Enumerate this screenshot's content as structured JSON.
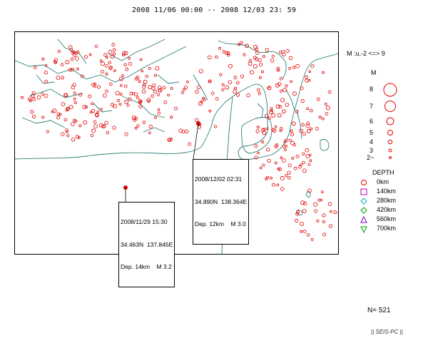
{
  "period": "2008  11/06 00:00 --  2008  12/03  23: 59",
  "legend": {
    "magnitude_range": "M :u,-2 <=> 9",
    "magnitude_title": "M",
    "magnitudes": [
      {
        "label": "8",
        "value": 8
      },
      {
        "label": "7",
        "value": 7
      },
      {
        "label": "6",
        "value": 6
      },
      {
        "label": "5",
        "value": 5
      },
      {
        "label": "4",
        "value": 4
      },
      {
        "label": "3",
        "value": 3
      },
      {
        "label": "2~",
        "value": 2
      }
    ],
    "depth_title": "DEPTH",
    "depths": [
      {
        "label": "0km",
        "shape": "circle",
        "color": "#e00000"
      },
      {
        "label": "140km",
        "shape": "square",
        "color": "#c000c0"
      },
      {
        "label": "280km",
        "shape": "diamond",
        "color": "#00b0c0"
      },
      {
        "label": "420km",
        "shape": "diamond",
        "color": "#00a000"
      },
      {
        "label": "560km",
        "shape": "triangle",
        "color": "#8000c0"
      },
      {
        "label": "700km",
        "shape": "triangle-down",
        "color": "#00a000"
      }
    ]
  },
  "callouts": [
    {
      "date": "2008/12/02 02:31",
      "coords": "34.890N  138.364E",
      "depth_mag": "Dep. 12km    M 3.0"
    },
    {
      "date": "2008/11/29 15:30",
      "coords": "34.463N  137.845E",
      "depth_mag": "Dep. 14km    M 3.2"
    }
  ],
  "count_label": "N= 521",
  "credit": "|| SEIS-PC ||",
  "colors": {
    "event": "#e00000",
    "fault": "#2f7f78",
    "coast": "#2f7f78"
  }
}
